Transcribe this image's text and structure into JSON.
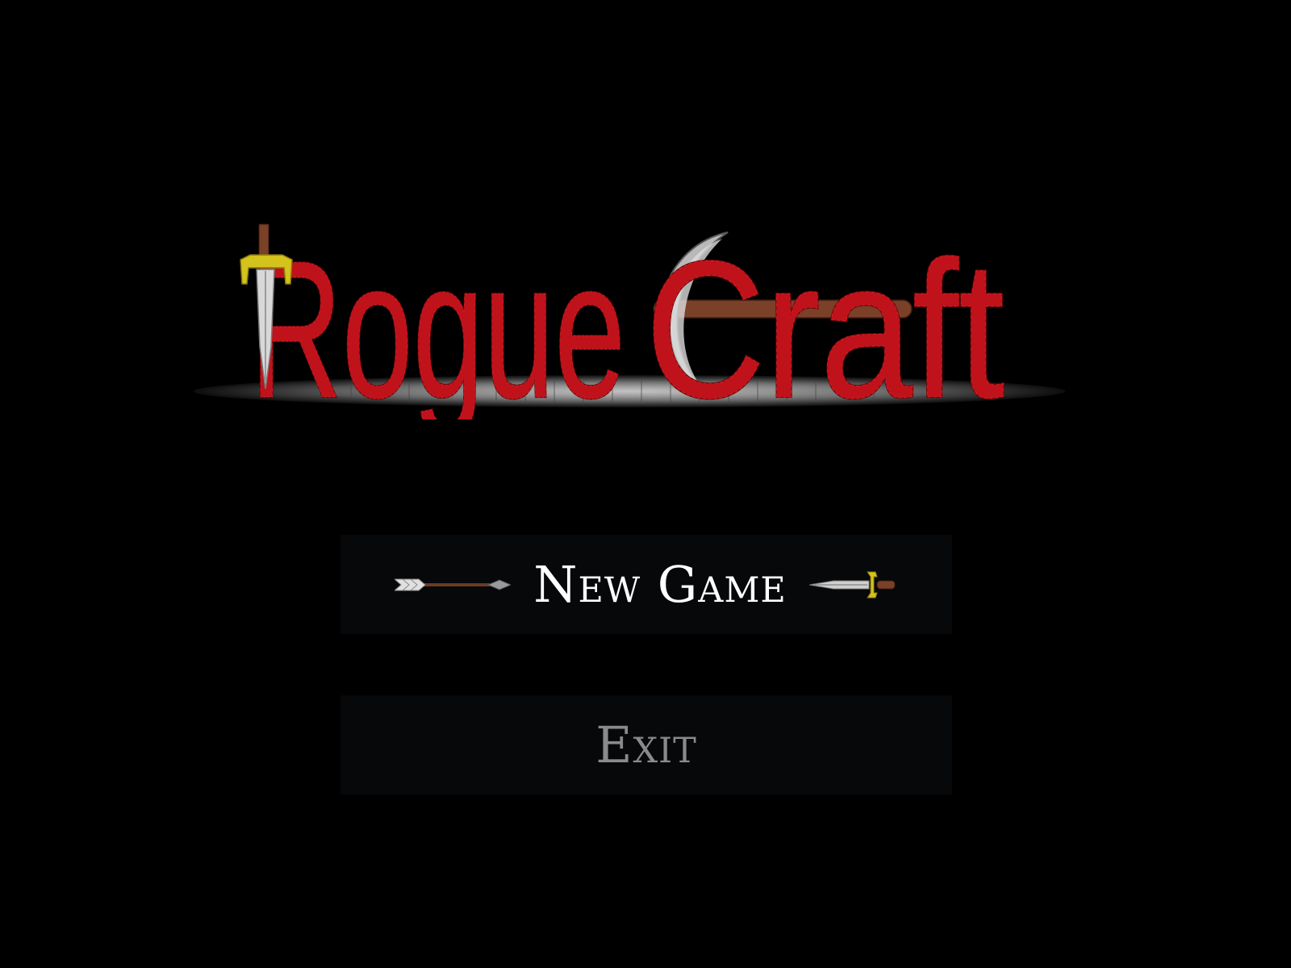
{
  "game": {
    "title_part1": "Rogue",
    "title_part2": "Craft"
  },
  "menu": {
    "items": [
      {
        "label": "New Game",
        "selected": true
      },
      {
        "label": "Exit",
        "selected": false
      }
    ]
  },
  "colors": {
    "background": "#000000",
    "title_red": "#c0121b",
    "button_bg": "#07080a",
    "selected_text": "#ffffff",
    "unselected_text": "#8a8a8a",
    "gold": "#c9b31a",
    "wood": "#6b3a22",
    "steel": "#c9c9c9"
  },
  "icons": {
    "title_dagger": "dagger-icon",
    "title_pickaxe": "pickaxe-icon",
    "selector_left": "arrow-icon",
    "selector_right": "dagger-icon"
  }
}
